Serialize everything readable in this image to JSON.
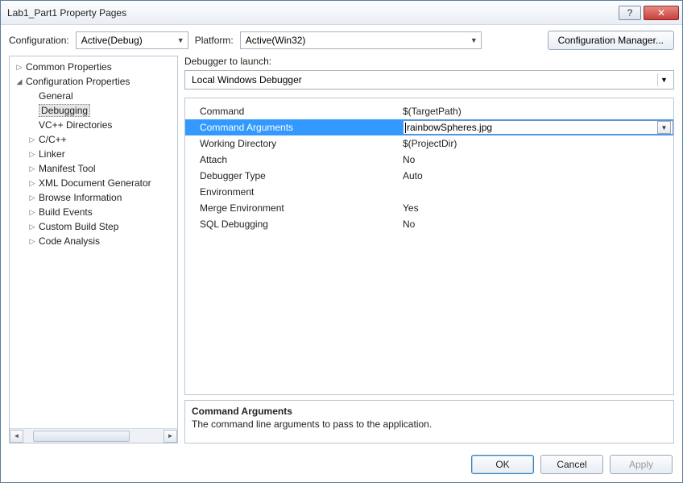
{
  "window": {
    "title": "Lab1_Part1 Property Pages"
  },
  "toprow": {
    "config_label": "Configuration:",
    "config_value": "Active(Debug)",
    "platform_label": "Platform:",
    "platform_value": "Active(Win32)",
    "cfg_mgr": "Configuration Manager..."
  },
  "tree": {
    "common": "Common Properties",
    "configprops": "Configuration Properties",
    "items": [
      "General",
      "Debugging",
      "VC++ Directories",
      "C/C++",
      "Linker",
      "Manifest Tool",
      "XML Document Generator",
      "Browse Information",
      "Build Events",
      "Custom Build Step",
      "Code Analysis"
    ]
  },
  "debugger": {
    "label": "Debugger to launch:",
    "value": "Local Windows Debugger"
  },
  "grid": {
    "rows": [
      {
        "name": "Command",
        "value": "$(TargetPath)"
      },
      {
        "name": "Command Arguments",
        "value": "rainbowSpheres.jpg"
      },
      {
        "name": "Working Directory",
        "value": "$(ProjectDir)"
      },
      {
        "name": "Attach",
        "value": "No"
      },
      {
        "name": "Debugger Type",
        "value": "Auto"
      },
      {
        "name": "Environment",
        "value": ""
      },
      {
        "name": "Merge Environment",
        "value": "Yes"
      },
      {
        "name": "SQL Debugging",
        "value": "No"
      }
    ]
  },
  "desc": {
    "title": "Command Arguments",
    "text": "The command line arguments to pass to the application."
  },
  "footer": {
    "ok": "OK",
    "cancel": "Cancel",
    "apply": "Apply"
  }
}
